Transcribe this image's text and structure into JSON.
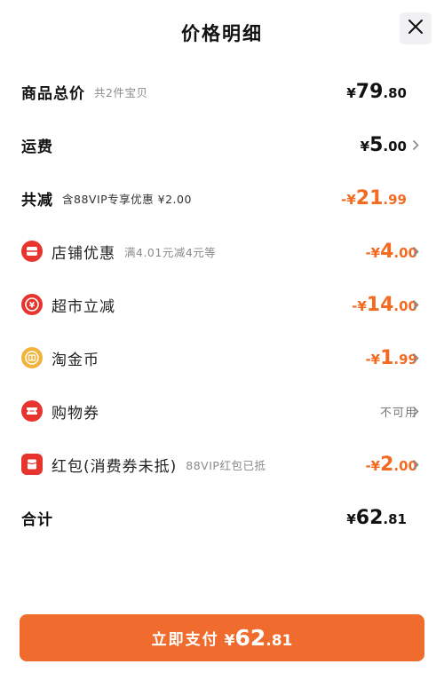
{
  "header": {
    "title": "价格明细"
  },
  "rows": {
    "total_goods": {
      "label": "商品总价",
      "sub": "共2件宝贝",
      "currency": "¥",
      "int": "79",
      "dec": ".80"
    },
    "shipping": {
      "label": "运费",
      "currency": "¥",
      "int": "5",
      "dec": ".00"
    },
    "discount_total": {
      "label": "共减",
      "sub": "含88VIP专享优惠 ¥2.00",
      "currency": "-¥",
      "int": "21",
      "dec": ".99"
    },
    "store_discount": {
      "label": "店铺优惠",
      "sub": "满4.01元减4元等",
      "currency": "-¥",
      "int": "4",
      "dec": ".00",
      "icon": "store-coupon-icon"
    },
    "supermarket": {
      "label": "超市立减",
      "currency": "-¥",
      "int": "14",
      "dec": ".00",
      "icon": "supermarket-discount-icon"
    },
    "gold_coin": {
      "label": "淘金币",
      "currency": "-¥",
      "int": "1",
      "dec": ".99",
      "icon": "gold-coin-icon"
    },
    "shopping_coupon": {
      "label": "购物券",
      "status": "不可用",
      "icon": "ticket-icon"
    },
    "red_packet": {
      "label": "红包(消费券未抵)",
      "sub": "88VIP红包已抵",
      "currency": "-¥",
      "int": "2",
      "dec": ".00",
      "icon": "red-packet-icon"
    },
    "grand_total": {
      "label": "合计",
      "currency": "¥",
      "int": "62",
      "dec": ".81"
    }
  },
  "pay_button": {
    "label": "立即支付",
    "currency": "¥",
    "int": "62",
    "dec": ".81"
  },
  "colors": {
    "accent": "#ef6c2e",
    "discount": "#f36b23",
    "red_icon": "#e8342f",
    "gold_icon": "#f2b33d"
  }
}
